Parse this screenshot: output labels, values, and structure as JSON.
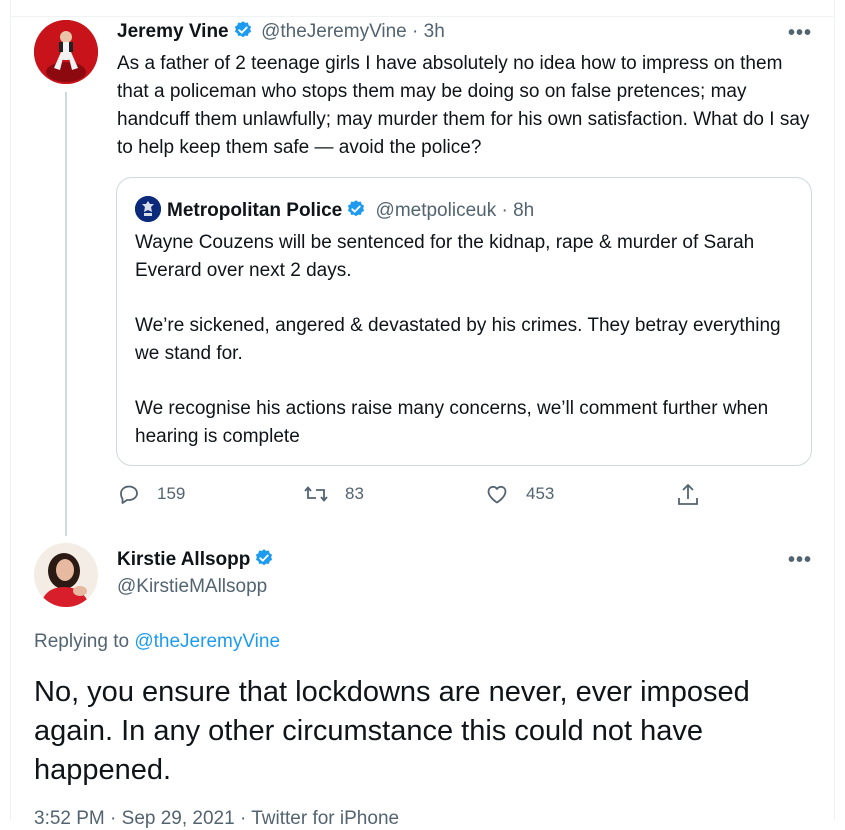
{
  "tweet": {
    "author_name": "Jeremy Vine",
    "handle_time": "@theJeremyVine · 3h",
    "text": "As a father of 2 teenage girls I have absolutely no idea how to impress on them that a policeman who stops them may be doing so on false pretences; may handcuff them unlawfully; may murder them for his own satisfaction. What do I say to help keep them safe — avoid the police?",
    "more_label": "•••",
    "quoted": {
      "author_name": "Metropolitan Police",
      "handle_time": "@metpoliceuk · 8h",
      "paragraphs": [
        "Wayne Couzens will be sentenced for the kidnap, rape & murder of Sarah Everard over next 2 days.",
        "We’re sickened, angered & devastated by his crimes. They betray everything we stand for.",
        "We recognise his actions raise many concerns, we’ll comment further when hearing is complete"
      ]
    },
    "actions": {
      "replies": "159",
      "retweets": "83",
      "likes": "453"
    }
  },
  "reply": {
    "author_name": "Kirstie Allsopp",
    "handle": "@KirstieMAllsopp",
    "replying_prefix": "Replying to ",
    "replying_handle": "@theJeremyVine",
    "text": "No, you ensure that lockdowns are never, ever imposed again. In any other circumstance this could not have happened.",
    "meta": "3:52 PM · Sep 29, 2021 · Twitter for iPhone",
    "more_label": "•••"
  },
  "colors": {
    "accent": "#1d9bf0",
    "muted": "#536471",
    "border": "#cfd9de"
  }
}
